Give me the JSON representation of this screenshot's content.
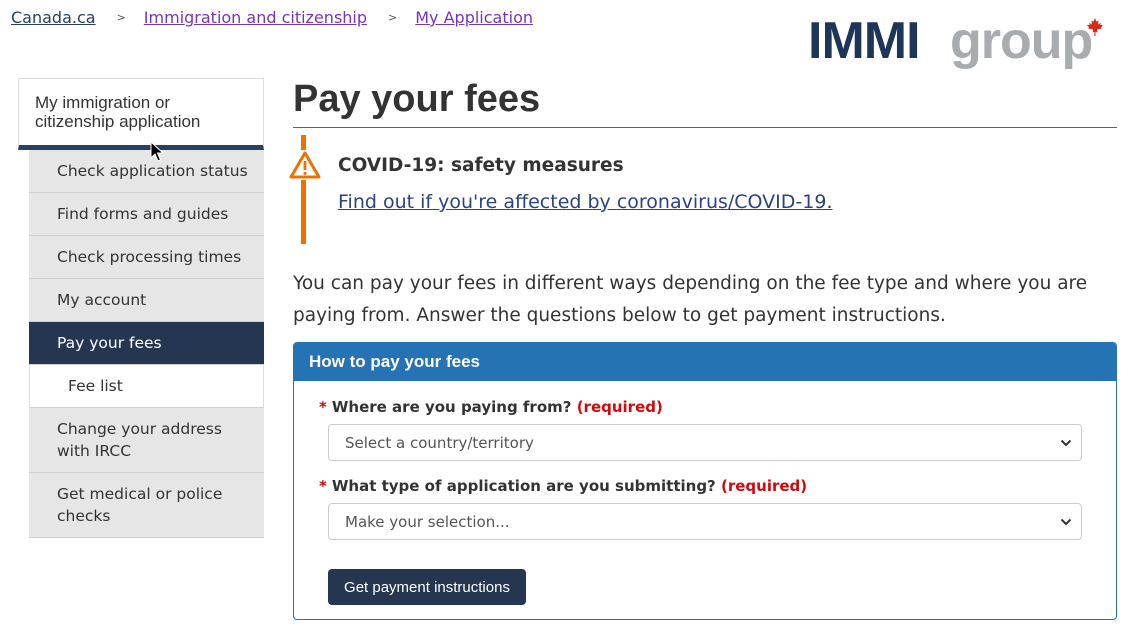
{
  "breadcrumb": {
    "home": "Canada.ca",
    "separator": ">",
    "items": [
      "Immigration and citizenship",
      "My Application"
    ]
  },
  "logo": {
    "part1": "IMMI",
    "part2": "group"
  },
  "sidebar": {
    "heading": "My immigration or citizenship application",
    "items": [
      {
        "label": "Check application status"
      },
      {
        "label": "Find forms and guides"
      },
      {
        "label": "Check processing times"
      },
      {
        "label": "My account"
      },
      {
        "label": "Pay your fees",
        "active": true
      },
      {
        "label": "Fee list",
        "sub": true
      },
      {
        "label": "Change your address with IRCC"
      },
      {
        "label": "Get medical or police checks"
      }
    ]
  },
  "page": {
    "title": "Pay your fees"
  },
  "alert": {
    "title": "COVID-19: safety measures",
    "link": "Find out if you're affected by coronavirus/COVID-19",
    "link_suffix": "."
  },
  "intro": "You can pay your fees in different ways depending on the fee type and where you are paying from. Answer the questions below to get payment instructions.",
  "panel": {
    "heading": "How to pay your fees",
    "q1": {
      "star": "*",
      "label": "Where are you paying from?",
      "required": "(required)",
      "placeholder": "Select a country/territory"
    },
    "q2": {
      "star": "*",
      "label": "What type of application are you submitting?",
      "required": "(required)",
      "placeholder": "Make your selection..."
    },
    "button": "Get payment instructions"
  },
  "colors": {
    "header_blue": "#2572b4",
    "nav_dark": "#243650",
    "alert_orange": "#ee7100",
    "required_red": "#d3080c",
    "link_purple": "#7834bc"
  }
}
